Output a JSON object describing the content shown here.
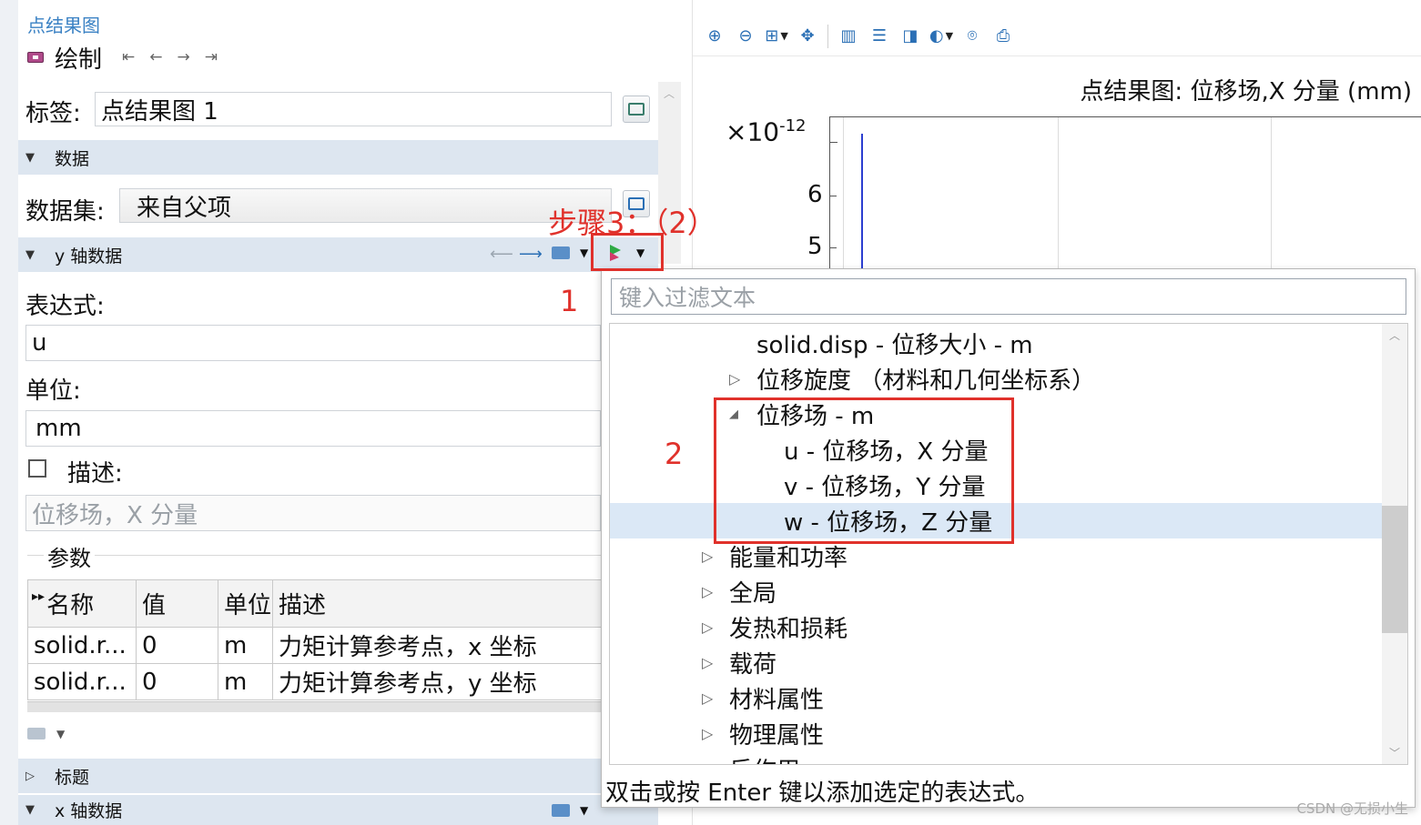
{
  "left_panel": {
    "breadcrumb": "点结果图",
    "plot_button": "绘制",
    "nav_icons": [
      "first-icon",
      "prev-icon",
      "next-icon",
      "last-icon"
    ],
    "label_caption": "标签:",
    "label_value": "点结果图 1",
    "section_data": "数据",
    "dataset_caption": "数据集:",
    "dataset_value": "来自父项",
    "section_y": "y 轴数据",
    "expr_caption": "表达式:",
    "expr_value": "u",
    "unit_caption": "单位:",
    "unit_value": "mm",
    "desc_caption": "描述:",
    "desc_value": "位移场，X 分量",
    "params_caption": "参数",
    "params_table": {
      "headers": [
        "名称",
        "值",
        "单位",
        "描述"
      ],
      "rows": [
        [
          "solid.r...",
          "0",
          "m",
          "力矩计算参考点，x 坐标"
        ],
        [
          "solid.r...",
          "0",
          "m",
          "力矩计算参考点，y 坐标"
        ]
      ]
    },
    "section_title": "标题",
    "section_x": "x 轴数据"
  },
  "plot_window": {
    "title": "点结果图: 位移场,X 分量 (mm)",
    "exponent_base": "×10",
    "exponent_power": "-12",
    "y_ticks": [
      "6",
      "5"
    ]
  },
  "popup": {
    "filter_placeholder": "键入过滤文本",
    "items": [
      {
        "text": "solid.disp - 位移大小 - m",
        "arrow": ""
      },
      {
        "text": "位移旋度 （材料和几何坐标系）",
        "arrow": "▷"
      },
      {
        "text": "位移场 - m",
        "arrow": "◢"
      },
      {
        "text": "u - 位移场，X 分量",
        "arrow": ""
      },
      {
        "text": "v - 位移场，Y 分量",
        "arrow": ""
      },
      {
        "text": "w - 位移场，Z 分量",
        "arrow": ""
      },
      {
        "text": "能量和功率",
        "arrow": "▷"
      },
      {
        "text": "全局",
        "arrow": "▷"
      },
      {
        "text": "发热和损耗",
        "arrow": "▷"
      },
      {
        "text": "载荷",
        "arrow": "▷"
      },
      {
        "text": "材料属性",
        "arrow": "▷"
      },
      {
        "text": "物理属性",
        "arrow": "▷"
      },
      {
        "text": "反作用",
        "arrow": "▷"
      }
    ],
    "hint": "双击或按 Enter 键以添加选定的表达式。"
  },
  "annotations": {
    "step_label": "步骤3：（2）",
    "num1": "1",
    "num2": "2",
    "color": "#e0312b"
  },
  "watermark": "CSDN @无损小生"
}
